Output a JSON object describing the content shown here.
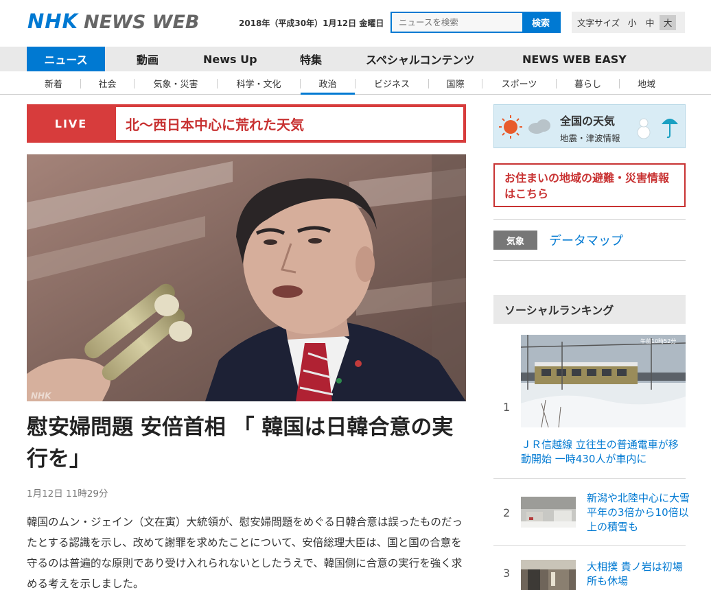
{
  "header": {
    "logo_nhk": "NHK",
    "logo_news": "NEWS WEB",
    "date": "2018年（平成30年）1月12日 金曜日",
    "search_placeholder": "ニュースを検索",
    "search_button": "検索",
    "fontsize_label": "文字サイズ",
    "fontsize_options": [
      "小",
      "中",
      "大"
    ],
    "fontsize_selected": "大"
  },
  "mainnav": [
    "ニュース",
    "動画",
    "News Up",
    "特集",
    "スペシャルコンテンツ",
    "NEWS WEB EASY"
  ],
  "subnav": [
    "新着",
    "社会",
    "気象・災害",
    "科学・文化",
    "政治",
    "ビジネス",
    "国際",
    "スポーツ",
    "暮らし",
    "地域"
  ],
  "subnav_active": "政治",
  "live": {
    "label": "LIVE",
    "text": "北～西日本中心に荒れた天気"
  },
  "hero": {
    "watermark": "NHK"
  },
  "article": {
    "headline": "慰安婦問題 安倍首相 「 韓国は日韓合意の実行を」",
    "timestamp": "1月12日 11時29分",
    "body": "韓国のムン・ジェイン（文在寅）大統領が、慰安婦問題をめぐる日韓合意は誤ったものだったとする認識を示し、改めて謝罪を求めたことについて、安倍総理大臣は、国と国の合意を守るのは普遍的な原則であり受け入れられないとしたうえで、韓国側に合意の実行を強く求める考えを示しました。"
  },
  "sidebar": {
    "weather_title": "全国の天気",
    "weather_sub": "地震・津波情報",
    "evac_text": "お住まいの地域の避難・災害情報はこちら",
    "datamap_tag": "気象",
    "datamap_link": "データマップ",
    "social_title": "ソーシャルランキング",
    "ranking": [
      {
        "rank": "1",
        "title": "ＪＲ信越線 立往生の普通電車が移動開始 一時430人が車内に",
        "image_caption": "午前10時52分"
      },
      {
        "rank": "2",
        "title": "新潟や北陸中心に大雪 平年の3倍から10倍以上の積雪も"
      },
      {
        "rank": "3",
        "title": "大相撲 貴ノ岩は初場所も休場"
      }
    ]
  },
  "colors": {
    "brand_blue": "#0079d2",
    "live_red": "#d73c3c",
    "nav_gray": "#e9e9e9"
  }
}
